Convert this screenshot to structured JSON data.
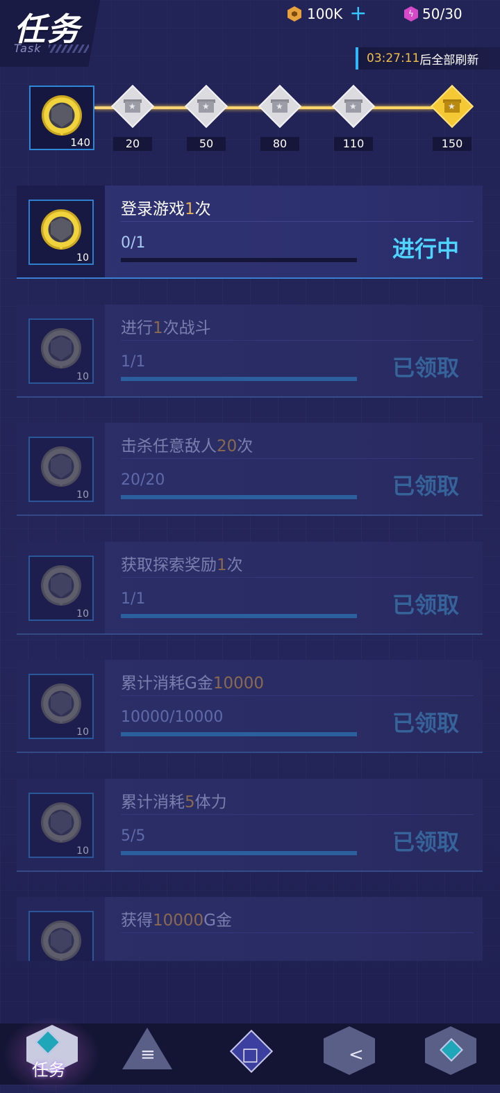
{
  "header": {
    "title": "任务",
    "subtitle": "Task",
    "coins": "100K",
    "energy": "50/30",
    "refresh_time": "03:27:11",
    "refresh_suffix": "后全部刷新"
  },
  "progress": {
    "current_points": "140",
    "milestones": [
      {
        "value": "20",
        "state": "available"
      },
      {
        "value": "50",
        "state": "available"
      },
      {
        "value": "80",
        "state": "available"
      },
      {
        "value": "110",
        "state": "available"
      },
      {
        "value": "150",
        "state": "gold"
      }
    ]
  },
  "tasks": [
    {
      "name_a": "登录游戏",
      "name_accent": "1",
      "name_b": "次",
      "reward": "10",
      "count": "0/1",
      "progress": 0,
      "status": "进行中",
      "state": "active"
    },
    {
      "name_a": "进行",
      "name_accent": "1",
      "name_b": "次战斗",
      "reward": "10",
      "count": "1/1",
      "progress": 1,
      "status": "已领取",
      "state": "done"
    },
    {
      "name_a": "击杀任意敌人",
      "name_accent": "20",
      "name_b": "次",
      "reward": "10",
      "count": "20/20",
      "progress": 1,
      "status": "已领取",
      "state": "done"
    },
    {
      "name_a": "获取探索奖励",
      "name_accent": "1",
      "name_b": "次",
      "reward": "10",
      "count": "1/1",
      "progress": 1,
      "status": "已领取",
      "state": "done"
    },
    {
      "name_a": "累计消耗G金",
      "name_accent": "10000",
      "name_b": "",
      "reward": "10",
      "count": "10000/10000",
      "progress": 1,
      "status": "已领取",
      "state": "done"
    },
    {
      "name_a": "累计消耗",
      "name_accent": "5",
      "name_b": "体力",
      "reward": "10",
      "count": "5/5",
      "progress": 1,
      "status": "已领取",
      "state": "done"
    },
    {
      "name_a": "获得",
      "name_accent": "10000",
      "name_b": "G金",
      "reward": "",
      "count": "",
      "progress": 0,
      "status": "",
      "state": "partial"
    }
  ],
  "nav": {
    "selected_label": "任务",
    "system_menu": "≡",
    "system_home": "□",
    "system_back": "<"
  }
}
